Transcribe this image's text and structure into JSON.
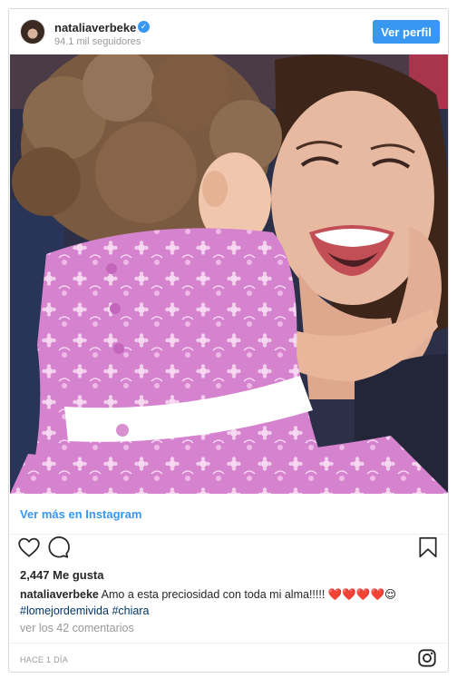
{
  "header": {
    "username": "nataliaverbeke",
    "verified_mark": "✓",
    "followers": "94.1 mil seguidores",
    "profile_button": "Ver perfil",
    "avatar_icon": "profile-avatar"
  },
  "photo": {
    "subject": "woman-laughing-holding-child-in-pink-dress",
    "colors": {
      "dress": "#d985cf",
      "sash": "#ffffff",
      "hair_child": "#8a6a4d",
      "hair_woman": "#3d2519",
      "skin": "#e7b9a1",
      "background": "#2a2e45"
    }
  },
  "view_more": "Ver más en Instagram",
  "actions": {
    "like_icon": "heart-outline",
    "comment_icon": "comment-bubble",
    "save_icon": "bookmark-outline"
  },
  "likes": "2,447 Me gusta",
  "caption": {
    "username": "nataliaverbeke",
    "text": "Amo a esta preciosidad con toda mi alma!!!!! ❤️❤️❤️❤️😌",
    "hashtag_1": "#lomejordemivida",
    "hashtag_2": "#chiara"
  },
  "comments_link": "ver los 42 comentarios",
  "footer": {
    "timestamp": "Hace 1 día",
    "brand_icon": "instagram-glyph"
  },
  "accent_color": "#3897f0"
}
